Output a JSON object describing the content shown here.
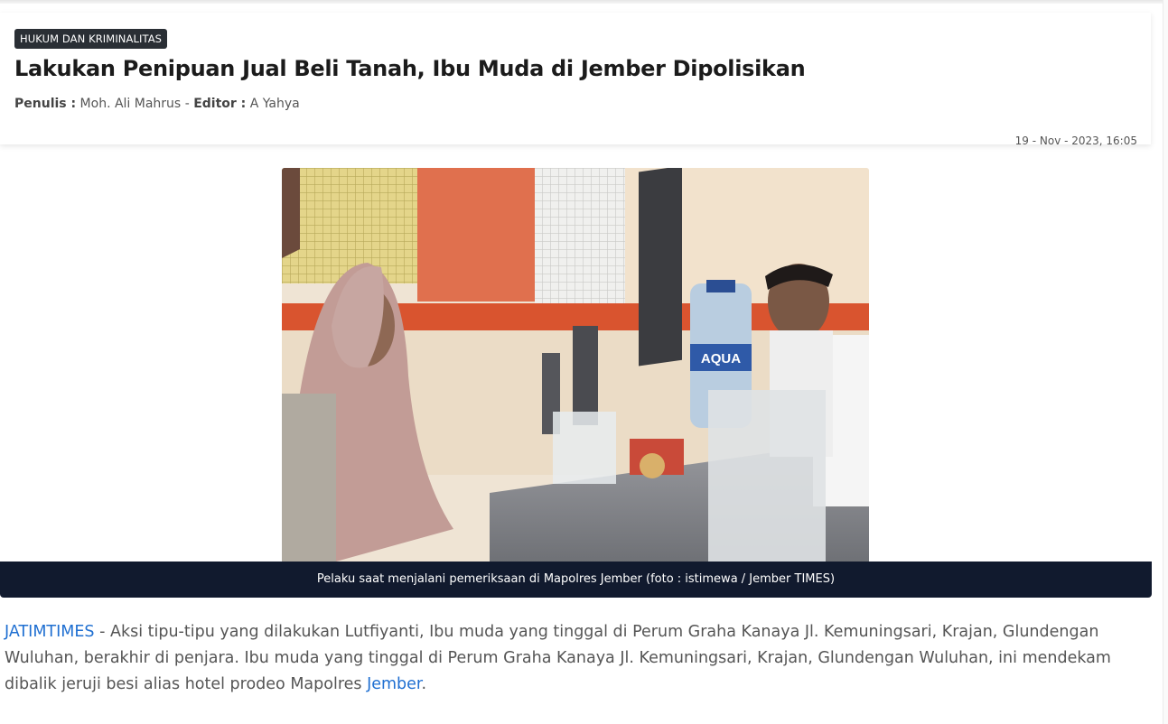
{
  "article": {
    "category": "HUKUM DAN KRIMINALITAS",
    "title": "Lakukan Penipuan Jual Beli Tanah, Ibu Muda di Jember Dipolisikan",
    "writer_label": "Penulis :",
    "writer": "Moh. Ali Mahrus",
    "separator": "-",
    "editor_label": "Editor :",
    "editor": "A Yahya",
    "date": "19 - Nov - 2023, 16:05"
  },
  "image": {
    "caption": "Pelaku saat menjalani pemeriksaan di Mapolres Jember (foto : istimewa / Jember TIMES)",
    "bottle_label": "AQUA"
  },
  "body": {
    "source": "JATIMTIMES",
    "text_part1": " - Aksi tipu-tipu yang dilakukan Lutfiyanti, Ibu muda yang tinggal di Perum Graha Kanaya Jl. Kemuningsari, Krajan, Glundengan Wuluhan, berakhir di penjara. Ibu muda yang tinggal di Perum Graha Kanaya Jl. Kemuningsari, Krajan, Glundengan Wuluhan, ini mendekam dibalik jeruji besi alias hotel prodeo Mapolres ",
    "link_text": "Jember",
    "text_end": "."
  },
  "colors": {
    "caption_bg": "#111a2e",
    "link": "#1f6fd1",
    "category_bg": "#2a2f35"
  }
}
